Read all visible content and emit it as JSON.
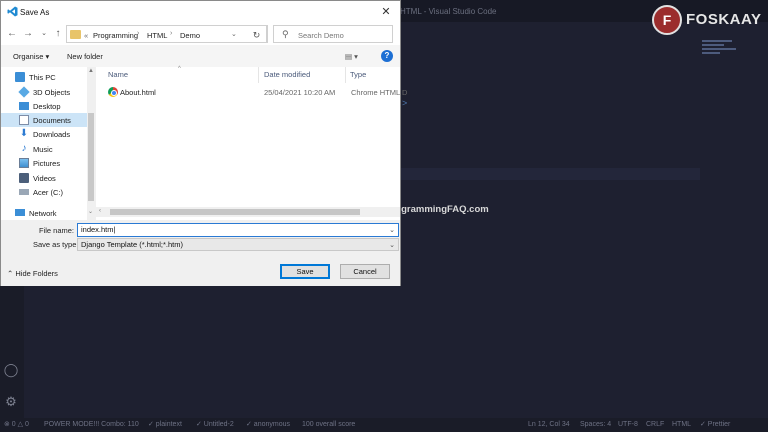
{
  "background": {
    "window_title": "HTML - Visual Studio Code",
    "watermark": "(c) ProgrammingFAQ.com",
    "logo_text": "FOSKAAY",
    "logo_badge": "F",
    "statusbar": {
      "errors": "⊗ 0 △ 0",
      "power_mode": "POWER MODE!!! Combo: 110",
      "plaintext": "✓ plaintext",
      "untitled": "✓ Untitled-2",
      "anonymous": "✓ anonymous",
      "score": "100 overall score",
      "position": "Ln 12, Col 34",
      "spaces": "Spaces: 4",
      "encoding": "UTF-8",
      "eol": "CRLF",
      "language": "HTML",
      "prettier": "✓ Prettier"
    }
  },
  "dialog": {
    "title": "Save As",
    "address": {
      "prefix": "«",
      "segments": [
        "Programming",
        "HTML",
        "Demo"
      ]
    },
    "search_placeholder": "Search Demo",
    "toolbar": {
      "organise": "Organise ▾",
      "new_folder": "New folder"
    },
    "nav_items": [
      {
        "label": "This PC",
        "icon": "pc-icon"
      },
      {
        "label": "3D Objects",
        "icon": "3d-objects-icon"
      },
      {
        "label": "Desktop",
        "icon": "desktop-icon"
      },
      {
        "label": "Documents",
        "icon": "documents-icon",
        "selected": true
      },
      {
        "label": "Downloads",
        "icon": "downloads-icon"
      },
      {
        "label": "Music",
        "icon": "music-icon"
      },
      {
        "label": "Pictures",
        "icon": "pictures-icon"
      },
      {
        "label": "Videos",
        "icon": "videos-icon"
      },
      {
        "label": "Acer (C:)",
        "icon": "drive-icon"
      },
      {
        "label": "Network",
        "icon": "network-icon"
      }
    ],
    "columns": {
      "name": "Name",
      "date_modified": "Date modified",
      "type": "Type"
    },
    "files": [
      {
        "name": "About.html",
        "date": "25/04/2021 10:20 AM",
        "type": "Chrome HTML D",
        "icon": "chrome-icon"
      }
    ],
    "form": {
      "file_name_label": "File name:",
      "file_name_value": "index.htm",
      "save_type_label": "Save as type:",
      "save_type_value": "Django Template (*.html;*.htm)"
    },
    "hide_folders": "Hide Folders",
    "save_label": "Save",
    "cancel_label": "Cancel"
  }
}
